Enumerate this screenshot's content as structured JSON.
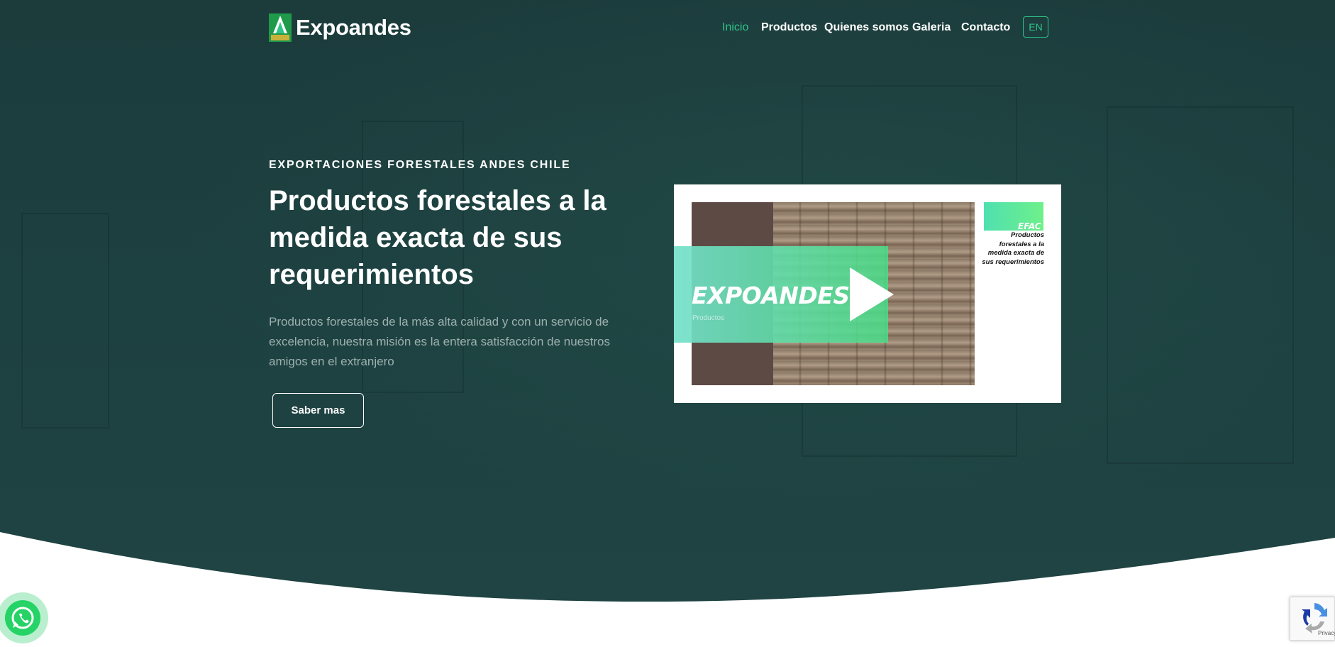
{
  "brand": {
    "name": "Expoandes",
    "accent_color": "#2fc48a",
    "hero_bg_color": "#1d4040"
  },
  "nav": {
    "items": [
      {
        "label": "Inicio",
        "active": true
      },
      {
        "label": "Productos",
        "active": false
      },
      {
        "label": "Quienes somos",
        "active": false
      },
      {
        "label": "Galeria",
        "active": false
      },
      {
        "label": "Contacto",
        "active": false
      }
    ],
    "lang_button": "EN"
  },
  "hero": {
    "eyebrow": "EXPORTACIONES FORESTALES ANDES CHILE",
    "headline": "Productos forestales a la medida exacta de sus requerimientos",
    "lead": "Productos forestales de la más alta calidad y con un servicio de excelencia, nuestra misión es la entera satisfacción de nuestros amigos en el extranjero",
    "cta_label": "Saber mas"
  },
  "video": {
    "title": "EXPOANDES",
    "subtitle": "Productos",
    "side_tag": "EFAC",
    "side_text": "Productos forestales a la medida exacta de sus requerimientos",
    "play_icon": "play-icon"
  },
  "floating": {
    "whatsapp_icon": "whatsapp-icon",
    "recaptcha_text": "Privacy - Terms"
  }
}
